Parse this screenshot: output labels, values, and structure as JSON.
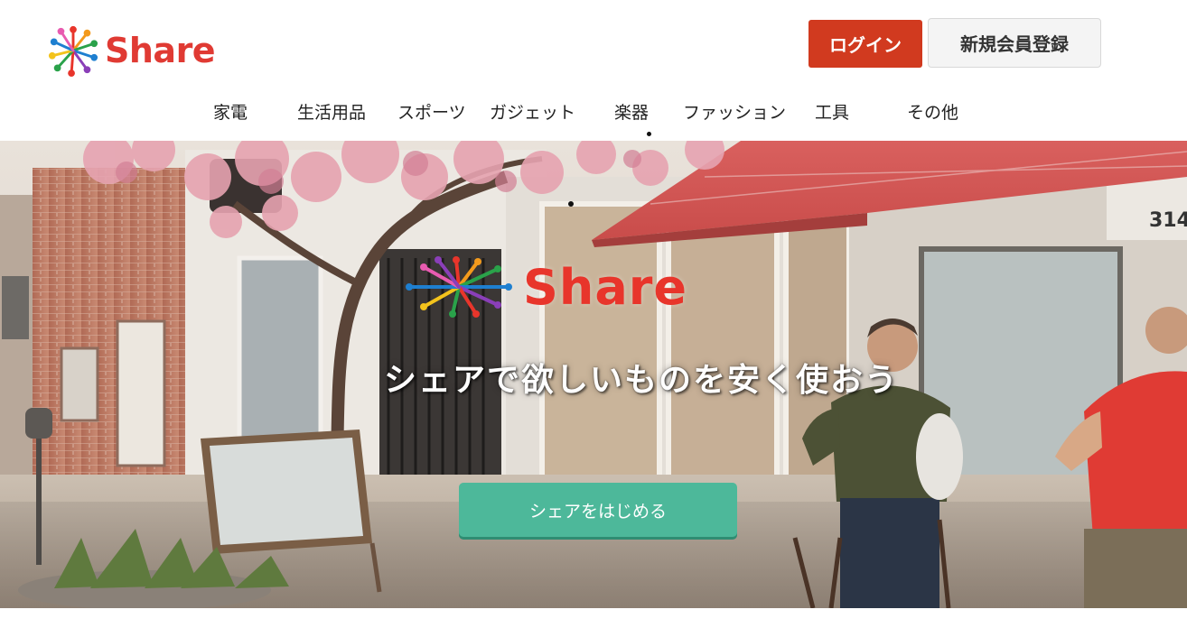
{
  "header": {
    "logo_text": "Share",
    "login_label": "ログイン",
    "register_label": "新規会員登録"
  },
  "nav": {
    "items": [
      "家電",
      "生活用品",
      "スポーツ",
      "ガジェット",
      "楽器",
      "ファッション",
      "工具",
      "その他"
    ]
  },
  "hero": {
    "logo_text": "Share",
    "tagline": "シェアで欲しいものを安く使おう",
    "cta_label": "シェアをはじめる",
    "storefront_number": "314"
  },
  "colors": {
    "brand_red": "#e03a33",
    "login_red": "#d13a1f",
    "cta_green": "#4db89a"
  }
}
